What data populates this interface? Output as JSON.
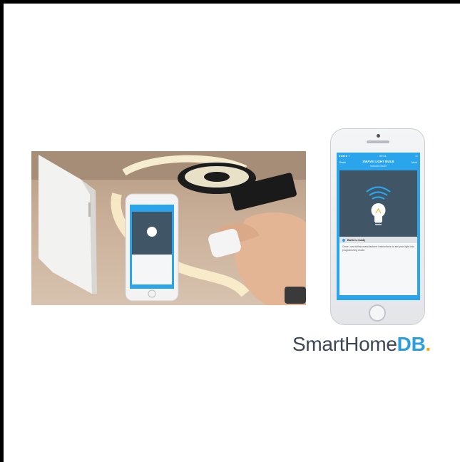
{
  "logo": {
    "main": "SmartHome",
    "accent": "DB",
    "dot": "."
  },
  "colors": {
    "brand_dark": "#3c4654",
    "brand_blue": "#2b9fde",
    "brand_dot": "#f0a81c",
    "app_blue": "#2aa4ea",
    "hero_bg": "#405566"
  },
  "app": {
    "status": {
      "carrier": "●●●●● ✓",
      "time": "09:41",
      "battery": "▭"
    },
    "nav": {
      "back": "Back",
      "title": "ZWAVE LIGHT BULB",
      "subtitle": "Inclusion Mode",
      "next": "Next"
    },
    "ready_label": "Bulb is ready",
    "message": "Once, now follow manufacturer instructions to set your light into programming mode."
  },
  "icons": {
    "hero": "wifi-bulb-icon",
    "ready": "info-dot-icon"
  }
}
